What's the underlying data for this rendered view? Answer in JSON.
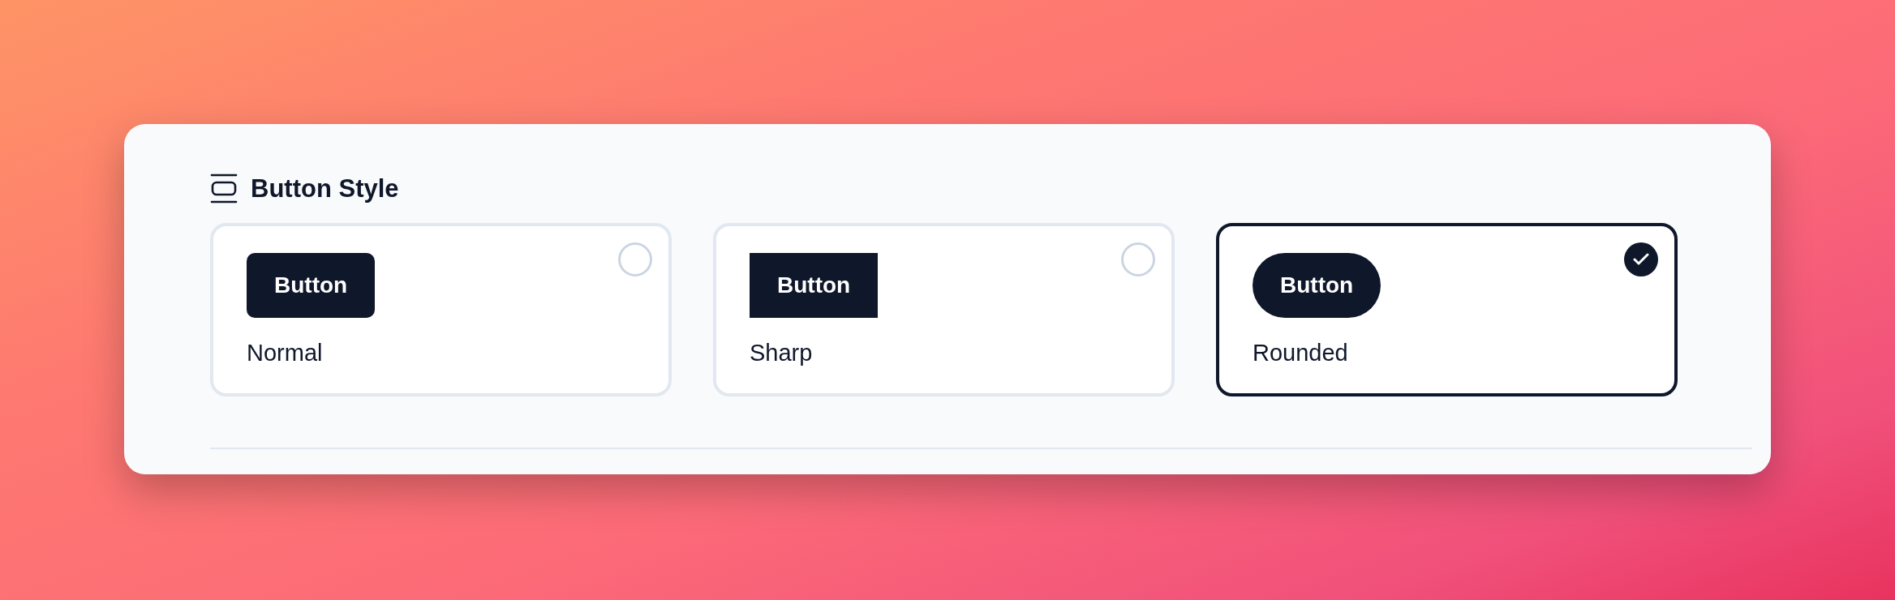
{
  "section": {
    "title": "Button Style"
  },
  "options": [
    {
      "kind": "normal",
      "preview": "Button",
      "label": "Normal",
      "selected": false
    },
    {
      "kind": "sharp",
      "preview": "Button",
      "label": "Sharp",
      "selected": false
    },
    {
      "kind": "rounded",
      "preview": "Button",
      "label": "Rounded",
      "selected": true
    }
  ]
}
